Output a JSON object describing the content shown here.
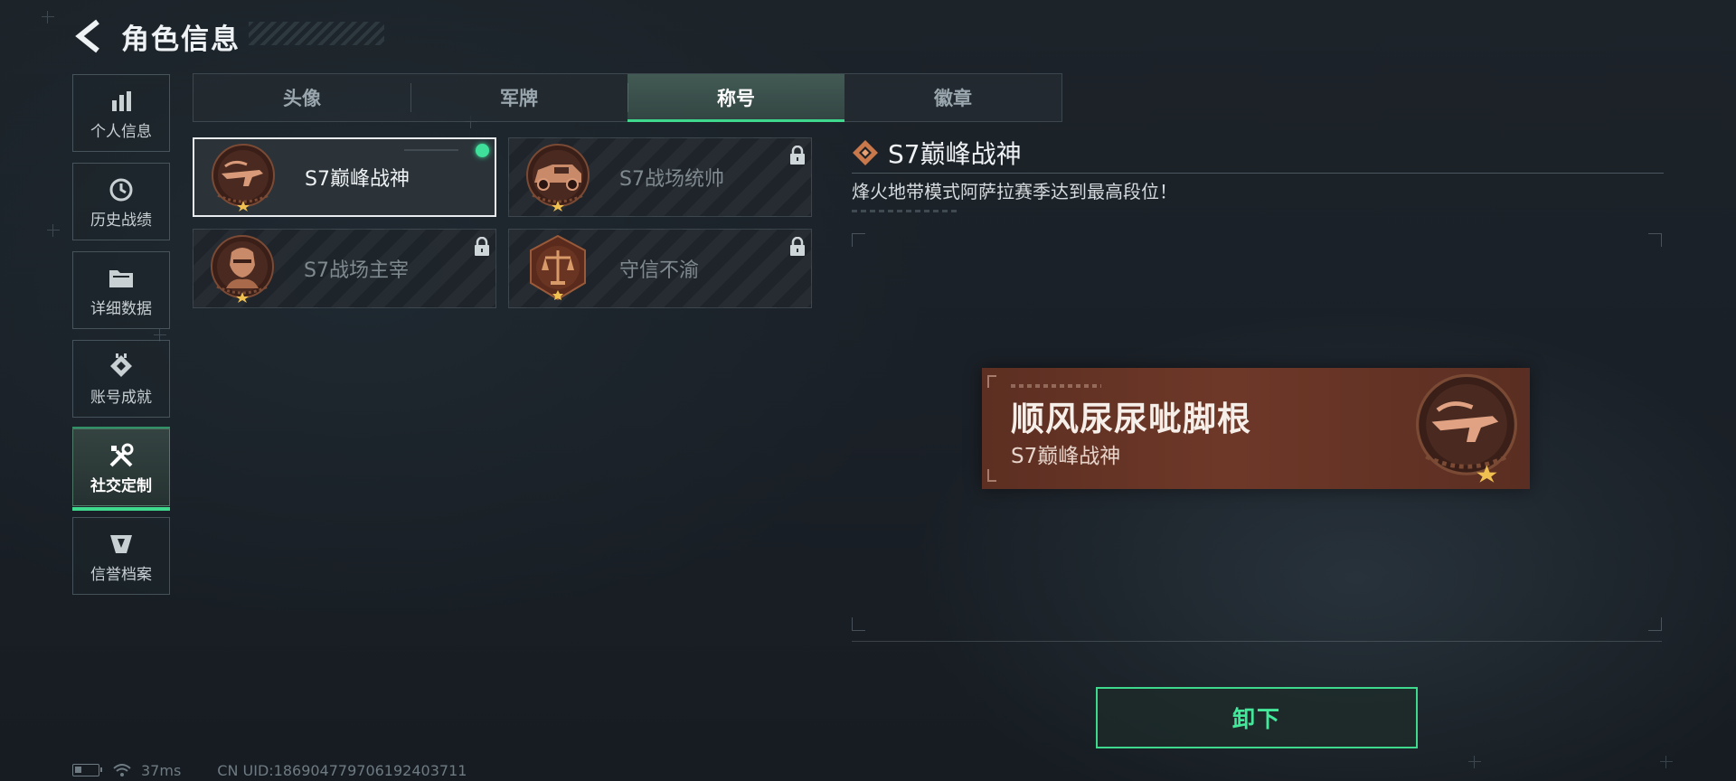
{
  "header": {
    "title": "角色信息"
  },
  "sidebar": {
    "items": [
      {
        "label": "个人信息",
        "icon": "bar-chart-icon"
      },
      {
        "label": "历史战绩",
        "icon": "history-clock-icon"
      },
      {
        "label": "详细数据",
        "icon": "folder-icon"
      },
      {
        "label": "账号成就",
        "icon": "achievement-icon"
      },
      {
        "label": "社交定制",
        "icon": "tools-icon",
        "active": true
      },
      {
        "label": "信誉档案",
        "icon": "credit-shield-icon"
      }
    ]
  },
  "tabs": [
    {
      "label": "头像"
    },
    {
      "label": "军牌"
    },
    {
      "label": "称号",
      "active": true
    },
    {
      "label": "徽章"
    }
  ],
  "titles": [
    {
      "name": "S7巅峰战神",
      "selected": true,
      "equipped": true,
      "locked": false,
      "emblem": "rifle-emblem-icon"
    },
    {
      "name": "S7战场统帅",
      "selected": false,
      "locked": true,
      "emblem": "vehicle-emblem-icon"
    },
    {
      "name": "S7战场主宰",
      "selected": false,
      "locked": true,
      "emblem": "soldier-emblem-icon"
    },
    {
      "name": "守信不渝",
      "selected": false,
      "locked": true,
      "emblem": "scales-emblem-icon"
    }
  ],
  "detail": {
    "title": "S7巅峰战神",
    "description": "烽火地带模式阿萨拉赛季达到最高段位！"
  },
  "nameplate": {
    "player_name": "顺风尿尿呲脚根",
    "title": "S7巅峰战神"
  },
  "actions": {
    "unequip_label": "卸下"
  },
  "status": {
    "ping": "37ms",
    "uid": "CN UID:1869047797061924037​11"
  },
  "colors": {
    "accent": "#3fd98e",
    "nameplate": "#6e3828",
    "bronze": "#a0603c"
  }
}
